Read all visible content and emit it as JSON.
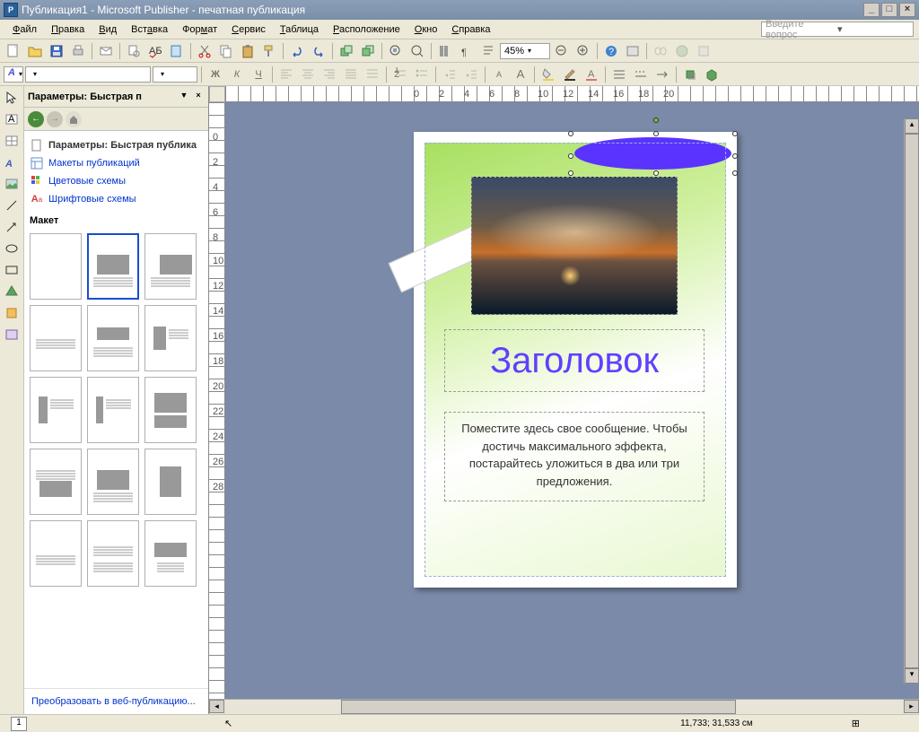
{
  "title": "Публикация1 - Microsoft Publisher - печатная публикация",
  "menus": [
    "Файл",
    "Правка",
    "Вид",
    "Вставка",
    "Формат",
    "Сервис",
    "Таблица",
    "Расположение",
    "Окно",
    "Справка"
  ],
  "helpbox_placeholder": "Введите вопрос",
  "zoom": "45%",
  "taskpane": {
    "title": "Параметры: Быстрая п",
    "links": {
      "params": "Параметры: Быстрая публика",
      "layouts": "Макеты публикаций",
      "colors": "Цветовые схемы",
      "fonts": "Шрифтовые схемы"
    },
    "section": "Макет",
    "convert": "Преобразовать в веб-публикацию..."
  },
  "page": {
    "title": "Заголовок",
    "body": "Поместите здесь свое сообщение. Чтобы достичь максимального эффекта, постарайтесь уложиться в два или три предложения."
  },
  "status": {
    "page": "1",
    "coords": "11,733; 31,533 см"
  },
  "ruler_h": [
    "0",
    "2",
    "4",
    "6",
    "8",
    "10",
    "12",
    "14",
    "16",
    "18",
    "20"
  ],
  "ruler_v": [
    "0",
    "2",
    "4",
    "6",
    "8",
    "10",
    "12",
    "14",
    "16",
    "18",
    "20",
    "22",
    "24",
    "26",
    "28"
  ]
}
